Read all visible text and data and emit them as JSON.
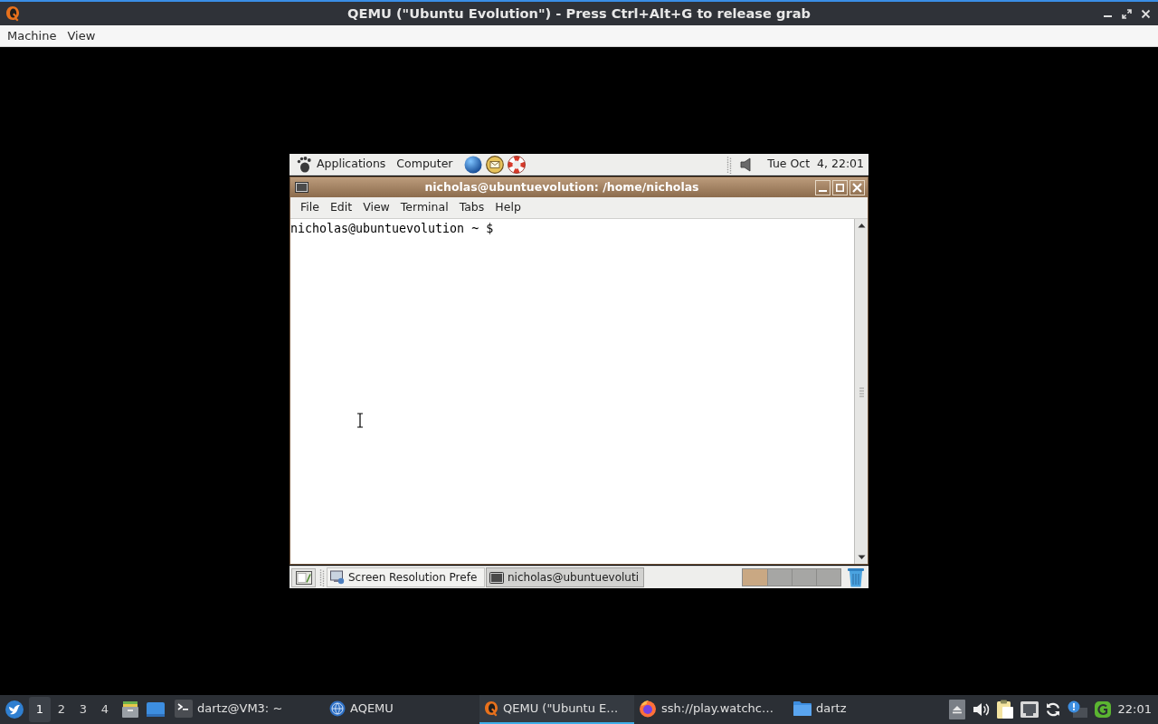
{
  "window": {
    "title": "QEMU (\"Ubuntu Evolution\") - Press Ctrl+Alt+G to release grab"
  },
  "menu_bar": [
    "Machine",
    "View"
  ],
  "guest_screen": {
    "top_panel": {
      "menus": [
        "Applications",
        "Computer"
      ],
      "clock": "Tue Oct  4, 22:01"
    },
    "terminal": {
      "title": "nicholas@ubuntuevolution: /home/nicholas",
      "menus": [
        "File",
        "Edit",
        "View",
        "Terminal",
        "Tabs",
        "Help"
      ],
      "lines": [
        "nicholas@ubuntuevolution ~ $"
      ]
    },
    "bottom_panel": {
      "tasks": [
        {
          "label": "Screen Resolution Prefe",
          "selected": false
        },
        {
          "label": "nicholas@ubuntuevoluti",
          "selected": true
        }
      ],
      "workspaces": [
        {
          "selected": true
        },
        {
          "selected": false
        },
        {
          "selected": false
        },
        {
          "selected": false
        }
      ]
    }
  },
  "taskbar": {
    "workspaces": [
      {
        "label": "1",
        "selected": true
      },
      {
        "label": "2",
        "selected": false
      },
      {
        "label": "3",
        "selected": false
      },
      {
        "label": "4",
        "selected": false
      }
    ],
    "tasks": [
      {
        "label": "dartz@VM3: ~",
        "selected": false
      },
      {
        "label": "AQEMU",
        "selected": false
      },
      {
        "label": "QEMU (\"Ubuntu E…",
        "selected": true
      },
      {
        "label": "ssh://play.watchc…",
        "selected": false
      },
      {
        "label": "dartz",
        "selected": false
      }
    ],
    "clock": "22:01"
  }
}
